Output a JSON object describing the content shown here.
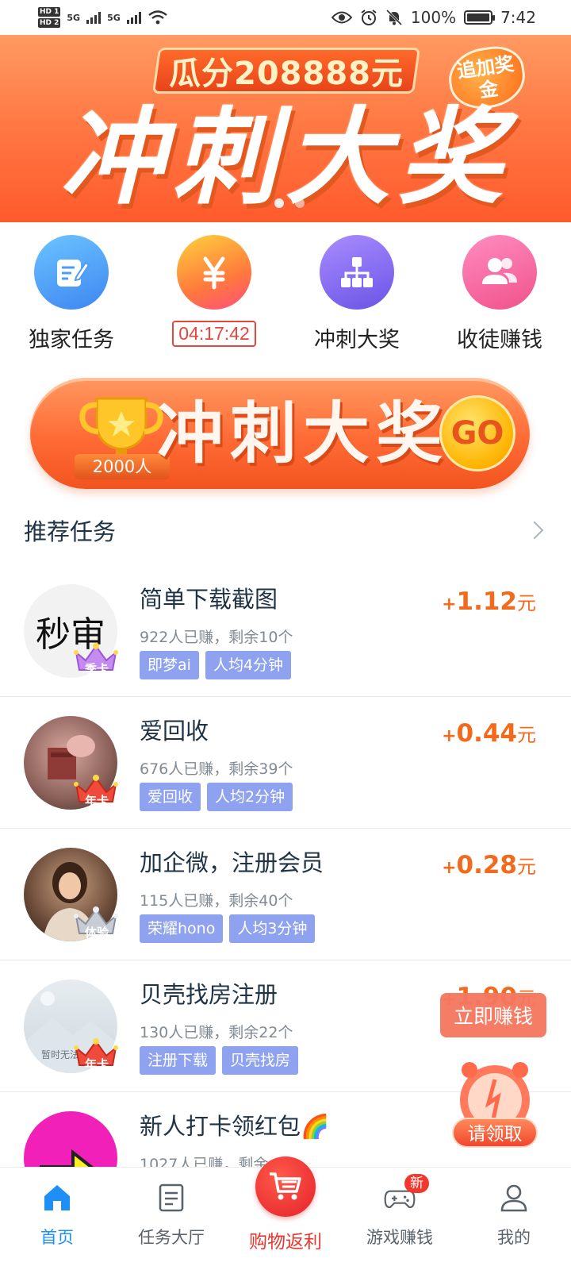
{
  "status_bar": {
    "hd1": "HD 1",
    "hd2": "HD 2",
    "net1": "5G",
    "net2": "5G",
    "battery": "100%",
    "time": "7:42"
  },
  "banner": {
    "subtitle": "瓜分208888元",
    "badge": "追加奖金",
    "title": "冲刺大奖"
  },
  "quick_nav": [
    {
      "label": "独家任务",
      "icon": "edit-icon",
      "color": "#4a9cf5"
    },
    {
      "label": "04:17:42",
      "icon": "yen-icon",
      "color": "#ff9f2a"
    },
    {
      "label": "冲刺大奖",
      "icon": "hierarchy-icon",
      "color": "#8a6cf0"
    },
    {
      "label": "收徒赚钱",
      "icon": "users-icon",
      "color": "#f26ba6"
    }
  ],
  "sprint_button": {
    "count": "2000人",
    "text": "冲刺大奖",
    "go": "GO"
  },
  "section": {
    "title": "推荐任务"
  },
  "tasks": [
    {
      "title": "简单下载截图",
      "meta": "922人已赚，剩余10个",
      "tags": [
        "即梦ai",
        "人均4分钟"
      ],
      "sign": "+",
      "amount": "1.12",
      "unit": "元",
      "avatar_text": "秒审",
      "crown": "季卡"
    },
    {
      "title": "爱回收",
      "meta": "676人已赚，剩余39个",
      "tags": [
        "爱回收",
        "人均2分钟"
      ],
      "sign": "+",
      "amount": "0.44",
      "unit": "元",
      "crown": "年卡"
    },
    {
      "title": "加企微，注册会员",
      "meta": "115人已赚，剩余40个",
      "tags": [
        "荣耀hono",
        "人均3分钟"
      ],
      "sign": "+",
      "amount": "0.28",
      "unit": "元",
      "crown": "体验"
    },
    {
      "title": "贝壳找房注册",
      "meta": "130人已赚，剩余22个",
      "tags": [
        "注册下载",
        "贝壳找房"
      ],
      "sign": "+",
      "amount": "1.90",
      "unit": "元",
      "avatar_text": "暂时无法",
      "crown": "年卡"
    },
    {
      "title": "新人打卡领红包🌈",
      "meta": "1027人已赚，剩余",
      "tags": [],
      "sign": "",
      "amount": "",
      "unit": ""
    }
  ],
  "floating": {
    "earn_now": "立即赚钱",
    "claim": "请领取"
  },
  "bottom_nav": [
    {
      "label": "首页",
      "icon": "home-icon",
      "active": true
    },
    {
      "label": "任务大厅",
      "icon": "list-icon"
    },
    {
      "label": "购物返利",
      "icon": "cart-icon"
    },
    {
      "label": "游戏赚钱",
      "icon": "gamepad-icon",
      "badge": "新"
    },
    {
      "label": "我的",
      "icon": "person-icon"
    }
  ],
  "colors": {
    "accent": "#1e8ff5",
    "reward": "#f26b1d",
    "tag": "#8fa2f0",
    "banner": "#ff7a45"
  }
}
